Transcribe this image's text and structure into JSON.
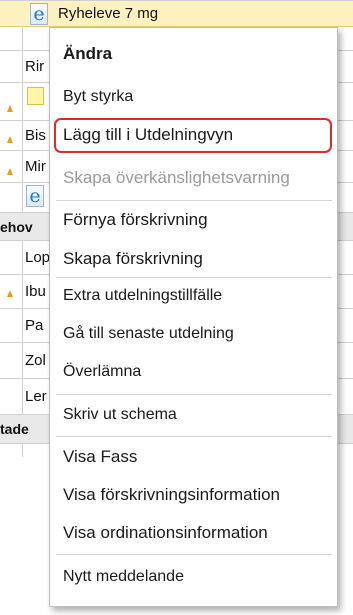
{
  "background_list": {
    "rows": [
      {
        "text": "Ryheleve  7 mg"
      },
      {
        "text": "Rir"
      },
      {
        "text": ""
      },
      {
        "text": "Bis"
      },
      {
        "text": "Mir"
      },
      {
        "text": ""
      },
      {
        "text": "ehov"
      },
      {
        "text": "Lop"
      },
      {
        "text": "Ibu"
      },
      {
        "text": "Pa"
      },
      {
        "text": "Zol"
      },
      {
        "text": "Ler"
      },
      {
        "text": "tade"
      }
    ],
    "icon_letter": "e"
  },
  "context_menu": {
    "items": [
      {
        "label": "Ändra"
      },
      {
        "label": "Byt styrka"
      },
      {
        "label": "Lägg till i Utdelningvyn"
      },
      {
        "label": "Skapa överkänslighetsvarning"
      },
      {
        "label": "Förnya förskrivning"
      },
      {
        "label": "Skapa förskrivning"
      },
      {
        "label": "Extra utdelningstillfälle"
      },
      {
        "label": "Gå till senaste utdelning"
      },
      {
        "label": "Överlämna"
      },
      {
        "label": "Skriv ut schema"
      },
      {
        "label": "Visa Fass"
      },
      {
        "label": "Visa förskrivningsinformation"
      },
      {
        "label": "Visa ordinationsinformation"
      },
      {
        "label": "Nytt meddelande"
      }
    ]
  },
  "colors": {
    "highlight_outline": "#e02a2a",
    "selected_row": "#fdf2c0",
    "disabled_text": "#9a9a9a"
  }
}
